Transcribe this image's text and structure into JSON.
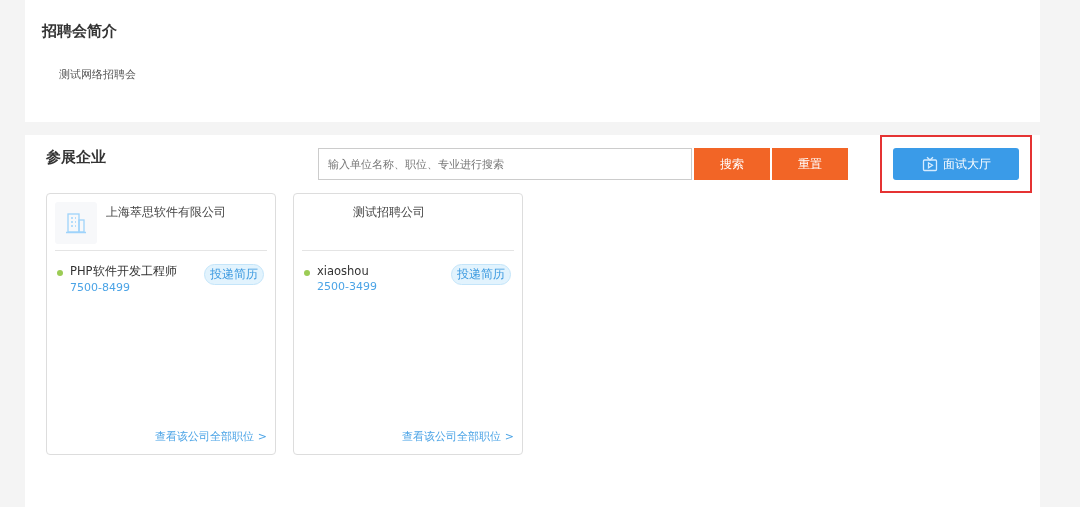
{
  "intro": {
    "title": "招聘会简介",
    "text": "测试网络招聘会"
  },
  "exhibitors": {
    "title": "参展企业",
    "search": {
      "placeholder": "输入单位名称、职位、专业进行搜索"
    },
    "buttons": [
      "搜索",
      "重置"
    ],
    "hall_button": {
      "label": "面试大厅",
      "highlighted": true
    },
    "companies": [
      {
        "name": "上海萃思软件有限公司",
        "logo": true,
        "jobs": [
          {
            "title": "PHP软件开发工程师",
            "salary": "7500-8499",
            "action": "投递简历"
          }
        ],
        "more": "查看该公司全部职位 >"
      },
      {
        "name": "测试招聘公司",
        "logo": false,
        "jobs": [
          {
            "title": "xiaoshou",
            "salary": "2500-3499",
            "action": "投递简历"
          }
        ],
        "more": "查看该公司全部职位 >"
      }
    ]
  }
}
